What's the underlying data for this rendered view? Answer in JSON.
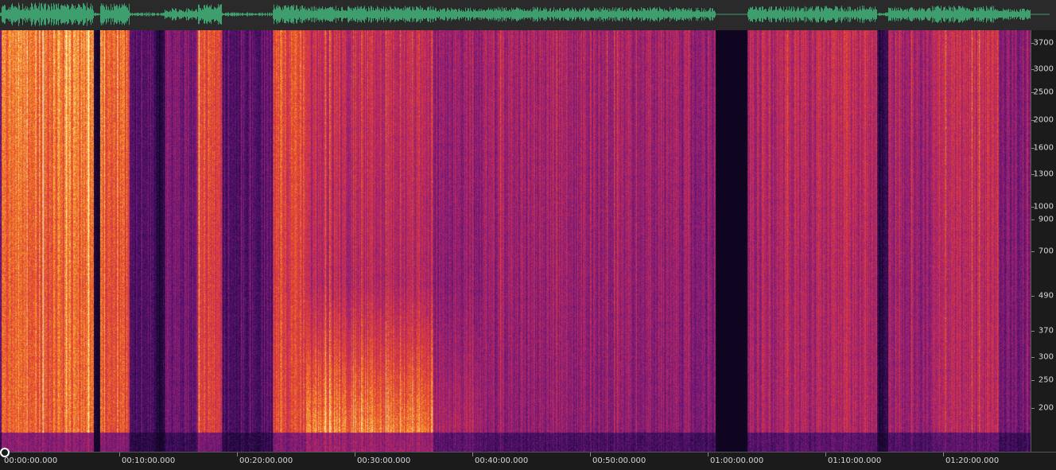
{
  "waveform": {
    "color": "#3f9e6e",
    "background": "#2a2a2a"
  },
  "spectrogram": {
    "palette": [
      "#0f0520",
      "#2b0a4a",
      "#5a1370",
      "#8d1f74",
      "#c22b5c",
      "#e4472f",
      "#f7962a",
      "#fff2b0"
    ],
    "duration_seconds": 5280,
    "segments_seconds": [
      {
        "start": 0,
        "end": 470,
        "energy": 0.82,
        "low_boost": 0.1
      },
      {
        "start": 470,
        "end": 500,
        "energy": 0.05,
        "low_boost": 0
      },
      {
        "start": 500,
        "end": 650,
        "energy": 0.78,
        "low_boost": 0.1
      },
      {
        "start": 650,
        "end": 780,
        "energy": 0.28,
        "low_boost": 0
      },
      {
        "start": 780,
        "end": 830,
        "energy": 0.12,
        "low_boost": 0
      },
      {
        "start": 830,
        "end": 1000,
        "energy": 0.4,
        "low_boost": 0
      },
      {
        "start": 1000,
        "end": 1120,
        "energy": 0.72,
        "low_boost": 0.1
      },
      {
        "start": 1120,
        "end": 1380,
        "energy": 0.3,
        "low_boost": 0
      },
      {
        "start": 1380,
        "end": 1550,
        "energy": 0.7,
        "low_boost": 0.15
      },
      {
        "start": 1550,
        "end": 2200,
        "energy": 0.58,
        "low_boost": 0.55
      },
      {
        "start": 2200,
        "end": 2450,
        "energy": 0.45,
        "low_boost": 0.2
      },
      {
        "start": 2450,
        "end": 3450,
        "energy": 0.5,
        "low_boost": 0
      },
      {
        "start": 3450,
        "end": 3640,
        "energy": 0.45,
        "low_boost": 0
      },
      {
        "start": 3640,
        "end": 3800,
        "energy": 0.0,
        "low_boost": 0
      },
      {
        "start": 3800,
        "end": 4150,
        "energy": 0.55,
        "low_boost": 0.05
      },
      {
        "start": 4150,
        "end": 4460,
        "energy": 0.58,
        "low_boost": 0.05
      },
      {
        "start": 4460,
        "end": 4520,
        "energy": 0.15,
        "low_boost": 0
      },
      {
        "start": 4520,
        "end": 4740,
        "energy": 0.5,
        "low_boost": 0.05
      },
      {
        "start": 4740,
        "end": 5080,
        "energy": 0.6,
        "low_boost": 0.05
      },
      {
        "start": 5080,
        "end": 5280,
        "energy": 0.42,
        "low_boost": 0
      }
    ]
  },
  "freq_axis": {
    "labels": [
      "3700",
      "3000",
      "2500",
      "2000",
      "1600",
      "1300",
      "1000",
      "900",
      "700",
      "490",
      "370",
      "300",
      "250",
      "200"
    ],
    "values": [
      3700,
      3000,
      2500,
      2000,
      1600,
      1300,
      1000,
      900,
      700,
      490,
      370,
      300,
      250,
      200
    ]
  },
  "time_axis": {
    "labels": [
      "00:00:00.000",
      "00:10:00.000",
      "00:20:00.000",
      "00:30:00.000",
      "00:40:00.000",
      "00:50:00.000",
      "01:00:00.000",
      "01:10:00.000",
      "01:20:00.000"
    ],
    "values_seconds": [
      0,
      600,
      1200,
      1800,
      2400,
      3000,
      3600,
      4200,
      4800
    ]
  }
}
